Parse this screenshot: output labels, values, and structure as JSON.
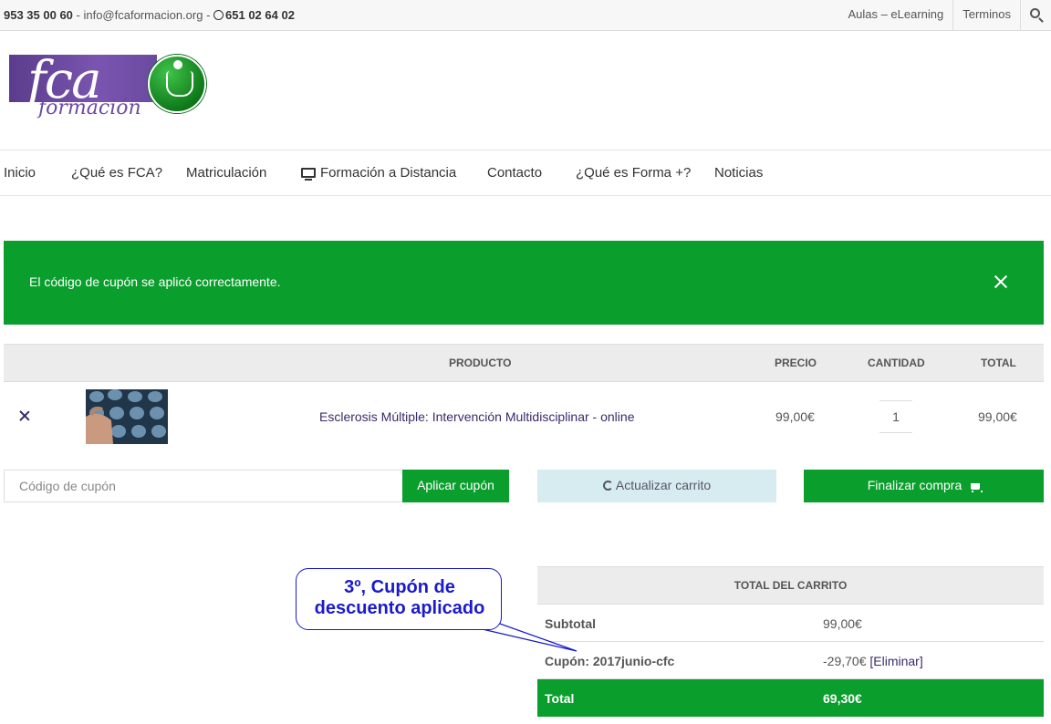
{
  "topbar": {
    "phone": "953 35 00 60",
    "separator1": " - ",
    "email": "info@fcaformacion.org",
    "separator2": " - ",
    "whatsapp": "651 02 64 02",
    "links": [
      "Aulas – eLearning",
      "Terminos"
    ]
  },
  "logo": {
    "main": "fca",
    "sub": "formación"
  },
  "nav": {
    "items": [
      "Inicio",
      "¿Qué es FCA?",
      "Matriculación",
      "Formación a Distancia",
      "Contacto",
      "¿Qué es Forma +?",
      "Noticias"
    ]
  },
  "notice": {
    "message": "El código de cupón se aplicó correctamente."
  },
  "cart": {
    "headers": {
      "product": "PRODUCTO",
      "price": "PRECIO",
      "quantity": "CANTIDAD",
      "total": "TOTAL"
    },
    "items": [
      {
        "name": "Esclerosis Múltiple: Intervención Multidisciplinar - online",
        "price": "99,00€",
        "quantity": "1",
        "total": "99,00€"
      }
    ]
  },
  "coupon": {
    "placeholder": "Código de cupón",
    "apply_label": "Aplicar cupón",
    "update_label": "Actualizar carrito",
    "checkout_label": "Finalizar compra"
  },
  "totals": {
    "title": "TOTAL DEL CARRITO",
    "subtotal_label": "Subtotal",
    "subtotal_value": "99,00€",
    "coupon_label": "Cupón: 2017junio-cfc",
    "coupon_value": "-29,70€",
    "coupon_remove": "[Eliminar]",
    "total_label": "Total",
    "total_value": "69,30€"
  },
  "callout": {
    "line1": "3º, Cupón de",
    "line2": "descuento aplicado"
  },
  "colors": {
    "accent_green": "#0a9e2d",
    "link_purple": "#3a2a6a",
    "callout_blue": "#1a1acc",
    "update_button_bg": "#d7ecf1"
  }
}
